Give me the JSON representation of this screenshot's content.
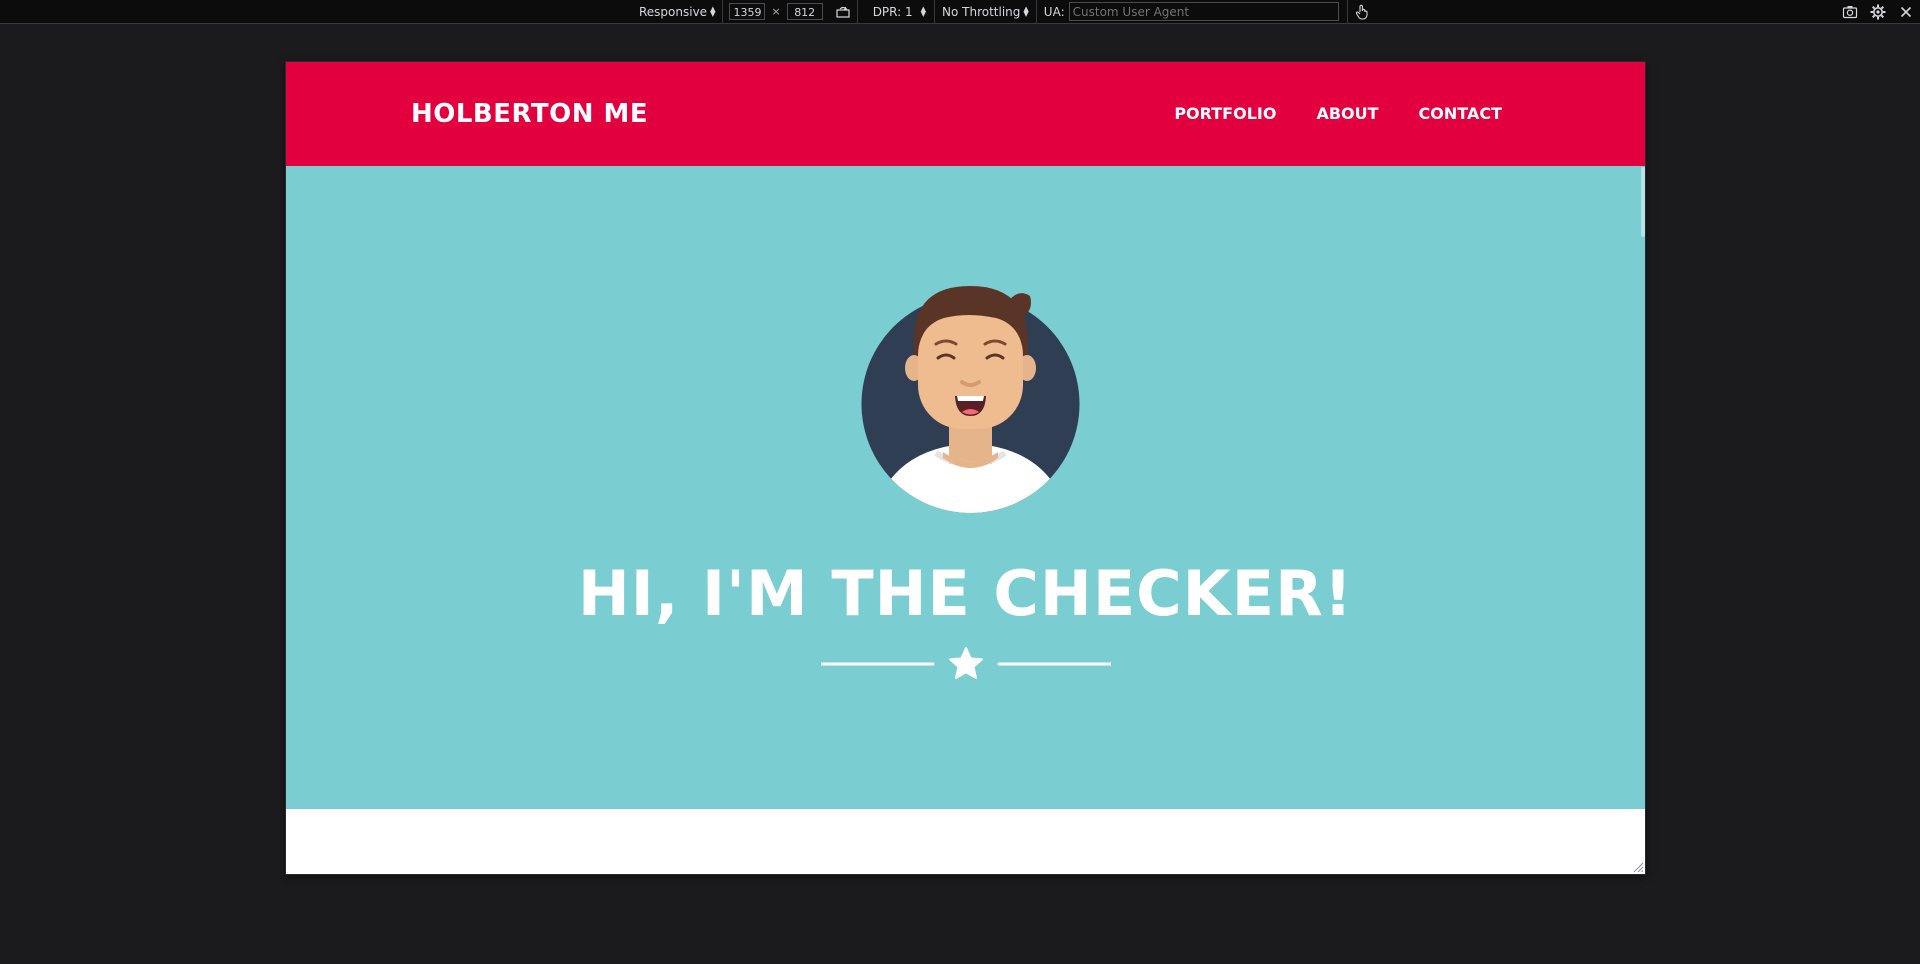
{
  "toolbar": {
    "device_label": "Responsive",
    "width": "1359",
    "times": "×",
    "height": "812",
    "dpr_label": "DPR: 1",
    "throttling_label": "No Throttling",
    "ua_label": "UA:",
    "ua_placeholder": "Custom User Agent",
    "icons": [
      "rotate-icon",
      "touch-icon",
      "screenshot-icon",
      "settings-icon",
      "close-icon"
    ]
  },
  "site": {
    "brand": "HOLBERTON ME",
    "nav": [
      "PORTFOLIO",
      "ABOUT",
      "CONTACT"
    ],
    "hero_title": "HI, I'M THE CHECKER!",
    "colors": {
      "header": "#e3003e",
      "hero": "#7acdd1",
      "text": "#ffffff"
    }
  }
}
